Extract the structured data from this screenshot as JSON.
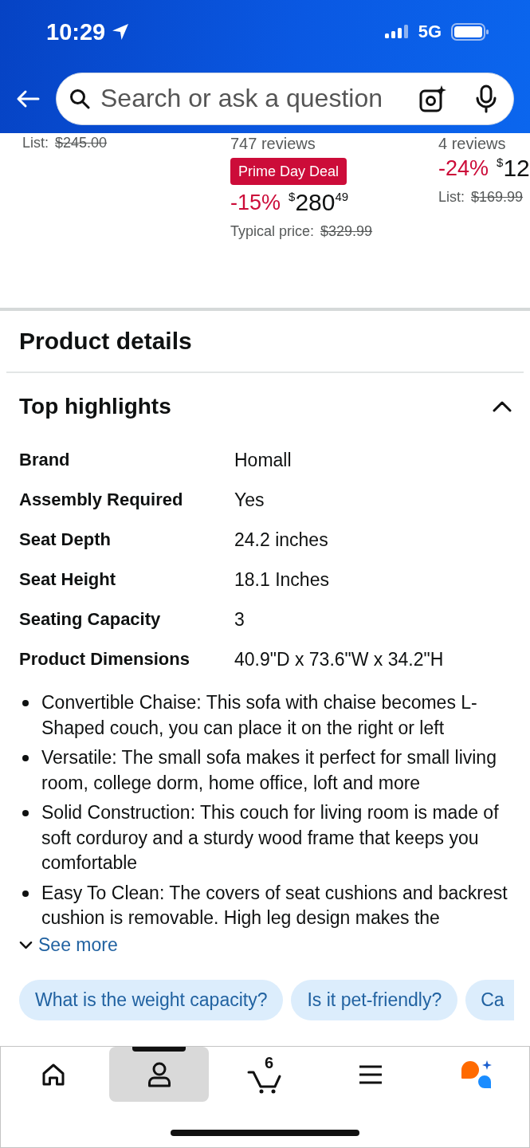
{
  "status_bar": {
    "time": "10:29",
    "network": "5G"
  },
  "search": {
    "placeholder": "Search or ask a question"
  },
  "carousel": [
    {
      "list_label": "List:",
      "list_price": "$245.00"
    },
    {
      "reviews": "747 reviews",
      "badge": "Prime Day Deal",
      "discount": "-15%",
      "price_symbol": "$",
      "price_whole": "280",
      "price_fraction": "49",
      "typical_label": "Typical price:",
      "typical_price": "$329.99"
    },
    {
      "reviews": "4 reviews",
      "discount": "-24%",
      "price_symbol": "$",
      "price_whole": "12",
      "list_label": "List:",
      "list_price": "$169.99"
    }
  ],
  "product_details": {
    "title": "Product details"
  },
  "top_highlights": {
    "title": "Top highlights",
    "expanded": true,
    "specs": [
      {
        "label": "Brand",
        "value": "Homall"
      },
      {
        "label": "Assembly Required",
        "value": "Yes"
      },
      {
        "label": "Seat Depth",
        "value": "24.2 inches"
      },
      {
        "label": "Seat Height",
        "value": "18.1 Inches"
      },
      {
        "label": "Seating Capacity",
        "value": "3"
      },
      {
        "label": "Product Dimensions",
        "value": "40.9\"D x 73.6\"W x 34.2\"H"
      }
    ],
    "bullets": [
      "Convertible Chaise: This sofa with chaise becomes L-Shaped couch, you can place it on the right or left",
      "Versatile: The small sofa makes it perfect for small living room, college dorm, home office, loft and more",
      "Solid Construction: This couch for living room is made of soft corduroy and a sturdy wood frame that keeps you comfortable",
      "Easy To Clean: The covers of seat cushions and backrest cushion is removable. High leg design makes the"
    ],
    "see_more": "See more"
  },
  "questions": [
    "What is the weight capacity?",
    "Is it pet-friendly?",
    "Ca"
  ],
  "bottom_nav": [
    {
      "kind": "home",
      "selected": false
    },
    {
      "kind": "account",
      "selected": true
    },
    {
      "kind": "cart",
      "selected": false,
      "count": "6"
    },
    {
      "kind": "menu",
      "selected": false
    },
    {
      "kind": "assistant",
      "selected": false
    }
  ]
}
